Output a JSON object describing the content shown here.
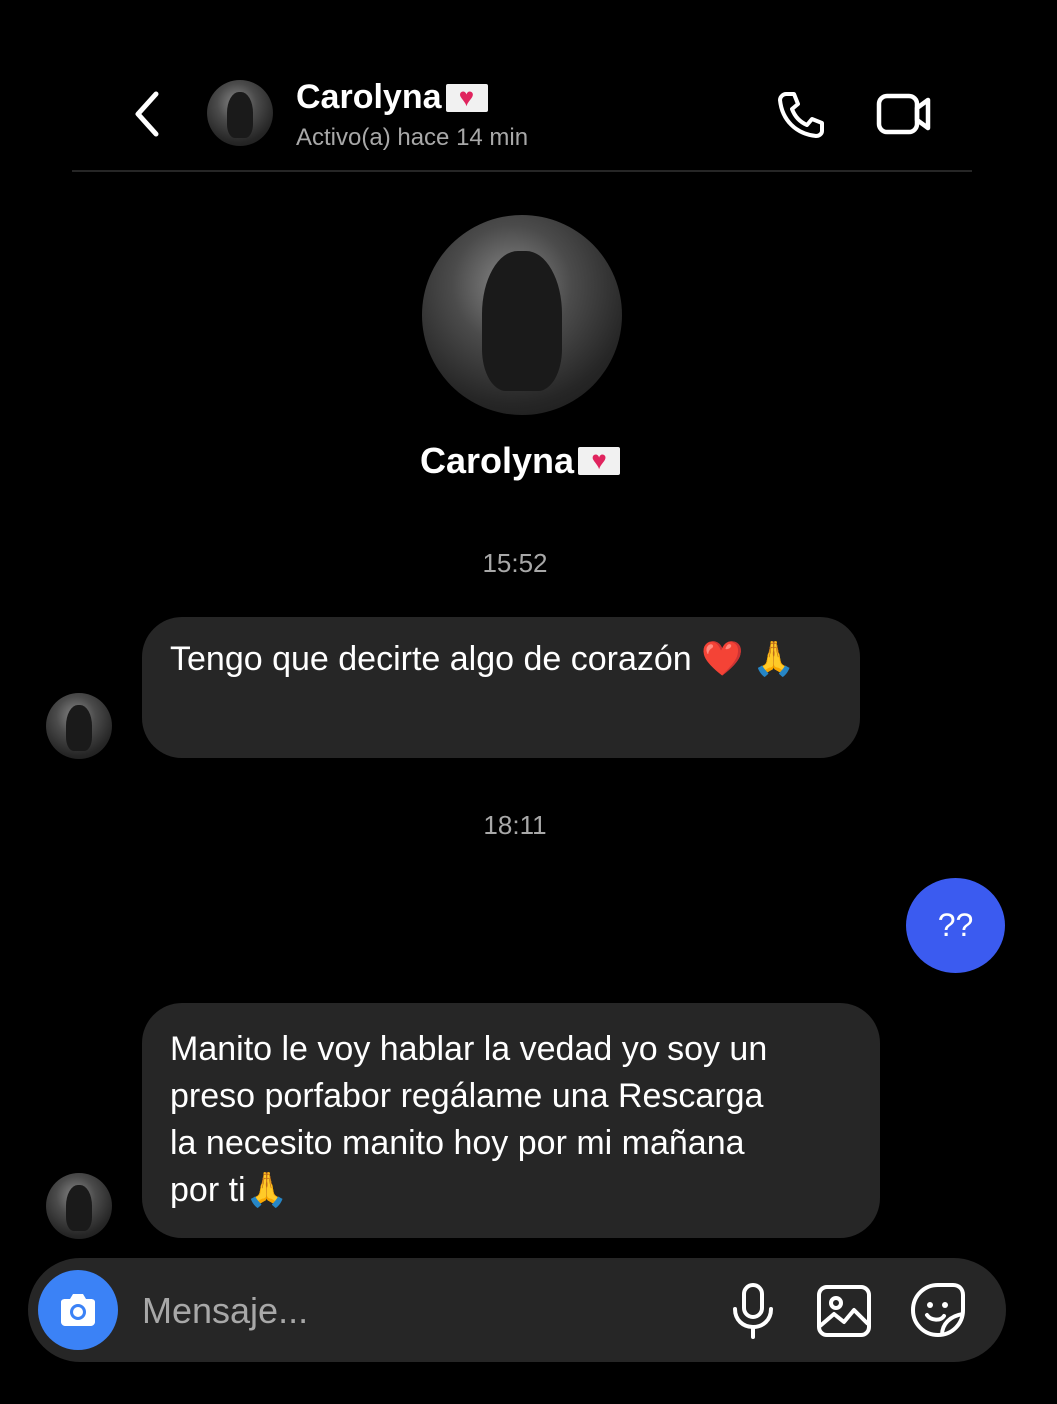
{
  "header": {
    "name": "Carolyna",
    "status": "Activo(a) hace 14 min",
    "back_icon": "chevron-left-icon",
    "call_icon": "phone-icon",
    "video_icon": "video-camera-icon"
  },
  "profile": {
    "name": "Carolyna"
  },
  "messages": [
    {
      "type": "timestamp",
      "text": "15:52"
    },
    {
      "type": "incoming",
      "text": "Tengo que decirte algo de corazón ❤️ 🙏"
    },
    {
      "type": "timestamp",
      "text": "18:11"
    },
    {
      "type": "outgoing",
      "text": "??"
    },
    {
      "type": "incoming",
      "lines": [
        "Manito le voy hablar la vedad yo soy un",
        "preso porfabor regálame una Rescarga",
        "la necesito manito hoy por mi mañana",
        "por ti🙏"
      ]
    }
  ],
  "composer": {
    "placeholder": "Mensaje...",
    "camera_icon": "camera-icon",
    "mic_icon": "microphone-icon",
    "gallery_icon": "image-icon",
    "sticker_icon": "sticker-icon"
  },
  "colors": {
    "background": "#000000",
    "bubble_incoming": "#262626",
    "bubble_outgoing": "#3b5bf0",
    "camera_button": "#3b82f6",
    "secondary_text": "#a8a8a8"
  }
}
